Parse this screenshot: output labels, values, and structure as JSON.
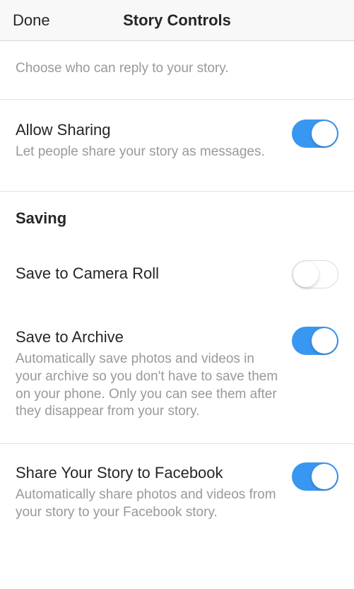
{
  "header": {
    "done_label": "Done",
    "title": "Story Controls"
  },
  "reply_hint": "Choose who can reply to your story.",
  "allow_sharing": {
    "title": "Allow Sharing",
    "desc": "Let people share your story as messages.",
    "on": true
  },
  "saving": {
    "section_title": "Saving",
    "camera_roll": {
      "title": "Save to Camera Roll",
      "on": false
    },
    "archive": {
      "title": "Save to Archive",
      "desc": "Automatically save photos and videos in your archive so you don't have to save them on your phone. Only you can see them after they disappear from your story.",
      "on": true
    }
  },
  "facebook": {
    "title": "Share Your Story to Facebook",
    "desc": "Automatically share photos and videos from your story to your Facebook story.",
    "on": true
  },
  "colors": {
    "toggle_on": "#3897f0"
  }
}
